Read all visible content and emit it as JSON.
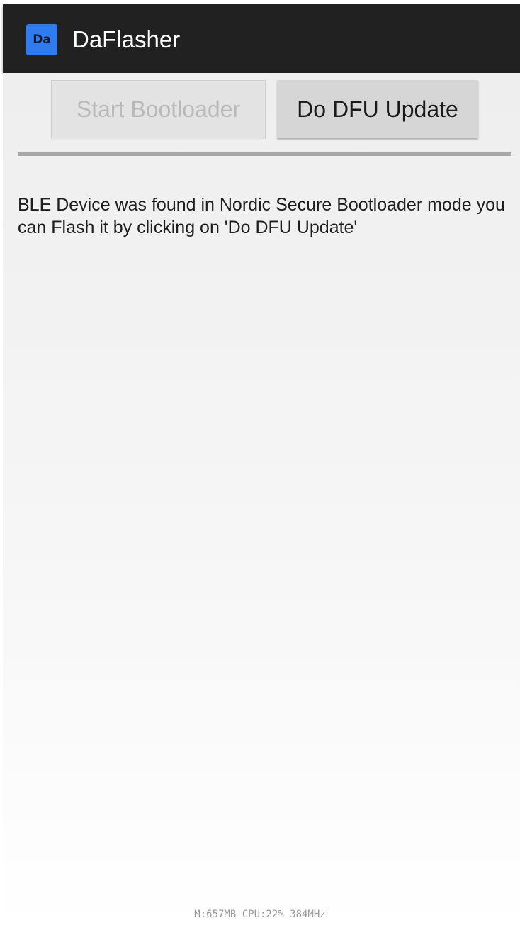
{
  "app_bar": {
    "icon_text": "Da",
    "icon_color": "#2f7cf0",
    "title": "DaFlasher"
  },
  "buttons": {
    "start_bootloader": "Start Bootloader",
    "start_bootloader_enabled": false,
    "do_dfu_update": "Do DFU Update",
    "do_dfu_update_enabled": true
  },
  "message": "BLE Device was found in Nordic Secure Bootloader mode you can Flash it by clicking on 'Do DFU Update'",
  "status_overlay": "M:657MB CPU:22% 384MHz"
}
